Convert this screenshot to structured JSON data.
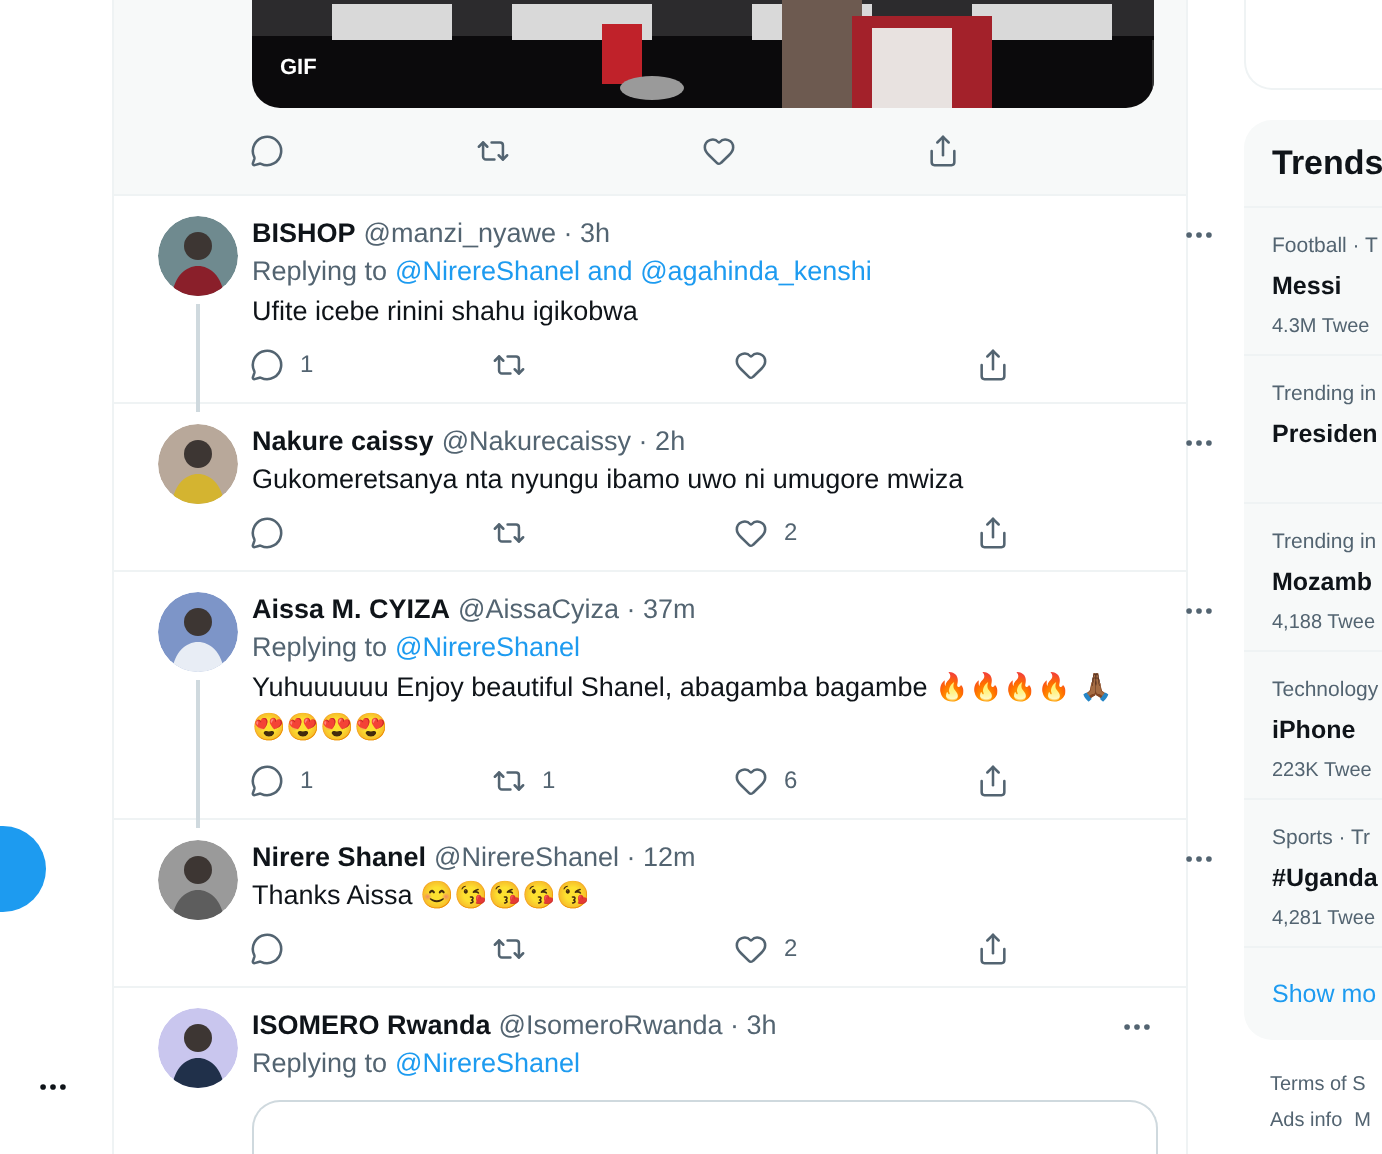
{
  "gif_tweet": {
    "badge": "GIF",
    "actions": [
      {
        "kind": "reply"
      },
      {
        "kind": "retweet"
      },
      {
        "kind": "like"
      },
      {
        "kind": "share"
      }
    ]
  },
  "tweets": [
    {
      "name": "BISHOP",
      "meta": "@manzi_nyawe · 3h",
      "thread": true,
      "replying": {
        "prefix": "Replying to",
        "link": "@NirereShanel and @agahinda_kenshi"
      },
      "text": "Ufite icebe rinini shahu igikobwa",
      "actions": [
        {
          "kind": "reply",
          "count": "1"
        },
        {
          "kind": "retweet"
        },
        {
          "kind": "like"
        },
        {
          "kind": "share"
        }
      ]
    },
    {
      "name": "Nakure caissy",
      "meta": "@Nakurecaissy · 2h",
      "thread": false,
      "text": "Gukomeretsanya nta nyungu ibamo uwo ni umugore mwiza",
      "actions": [
        {
          "kind": "reply"
        },
        {
          "kind": "retweet"
        },
        {
          "kind": "like",
          "count": "2"
        },
        {
          "kind": "share"
        }
      ]
    },
    {
      "name": "Aissa M. CYIZA",
      "meta": "@AissaCyiza · 37m",
      "thread": true,
      "replying": {
        "prefix": "Replying to",
        "link": "@NirereShanel"
      },
      "text": "Yuhuuuuuu Enjoy beautiful Shanel, abagamba bagambe 🔥🔥🔥🔥 🙏🏾😍😍😍😍",
      "actions": [
        {
          "kind": "reply",
          "count": "1"
        },
        {
          "kind": "retweet",
          "count": "1"
        },
        {
          "kind": "like",
          "count": "6"
        },
        {
          "kind": "share"
        }
      ]
    },
    {
      "name": "Nirere Shanel",
      "meta": "@NirereShanel · 12m",
      "thread": false,
      "text": "Thanks Aissa 😊😘😘😘😘",
      "actions": [
        {
          "kind": "reply"
        },
        {
          "kind": "retweet"
        },
        {
          "kind": "like",
          "count": "2"
        },
        {
          "kind": "share"
        }
      ]
    },
    {
      "name": "ISOMERO Rwanda",
      "meta": "@IsomeroRwanda · 3h",
      "thread": false,
      "replying": {
        "prefix": "Replying to",
        "link": "@NirereShanel"
      }
    }
  ],
  "trends": {
    "title": "Trends",
    "items": [
      {
        "context": "Football · T",
        "name": "Messi",
        "count": "4.3M Twee"
      },
      {
        "context": "Trending in",
        "name": "Presiden"
      },
      {
        "context": "Trending in",
        "name": "Mozamb",
        "count": "4,188 Twee"
      },
      {
        "context": "Technology",
        "name": "iPhone",
        "count": "223K Twee"
      },
      {
        "context": "Sports · Tr",
        "name": "#Uganda",
        "count": "4,281 Twee"
      }
    ],
    "show_more": "Show mo"
  },
  "footer": {
    "links": [
      "Terms of S",
      "Ads info",
      "M"
    ]
  }
}
